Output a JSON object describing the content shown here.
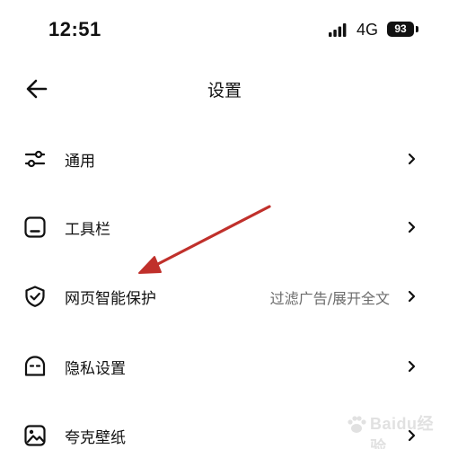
{
  "status_bar": {
    "time": "12:51",
    "network": "4G",
    "battery": "93"
  },
  "nav": {
    "title": "设置",
    "back_icon": "arrow-left-icon"
  },
  "settings": {
    "items": [
      {
        "label": "通用",
        "value": "",
        "icon": "sliders-icon"
      },
      {
        "label": "工具栏",
        "value": "",
        "icon": "toolbar-icon"
      },
      {
        "label": "网页智能保护",
        "value": "过滤广告/展开全文",
        "icon": "shield-check-icon"
      },
      {
        "label": "隐私设置",
        "value": "",
        "icon": "privacy-face-icon"
      },
      {
        "label": "夸克壁纸",
        "value": "",
        "icon": "wallpaper-icon"
      }
    ]
  },
  "annotation": {
    "arrow_color": "#c0302b"
  },
  "watermark": {
    "text": "Baidu经验"
  },
  "colors": {
    "text_primary": "#111111",
    "text_secondary": "#6b6b6b",
    "background": "#ffffff"
  }
}
